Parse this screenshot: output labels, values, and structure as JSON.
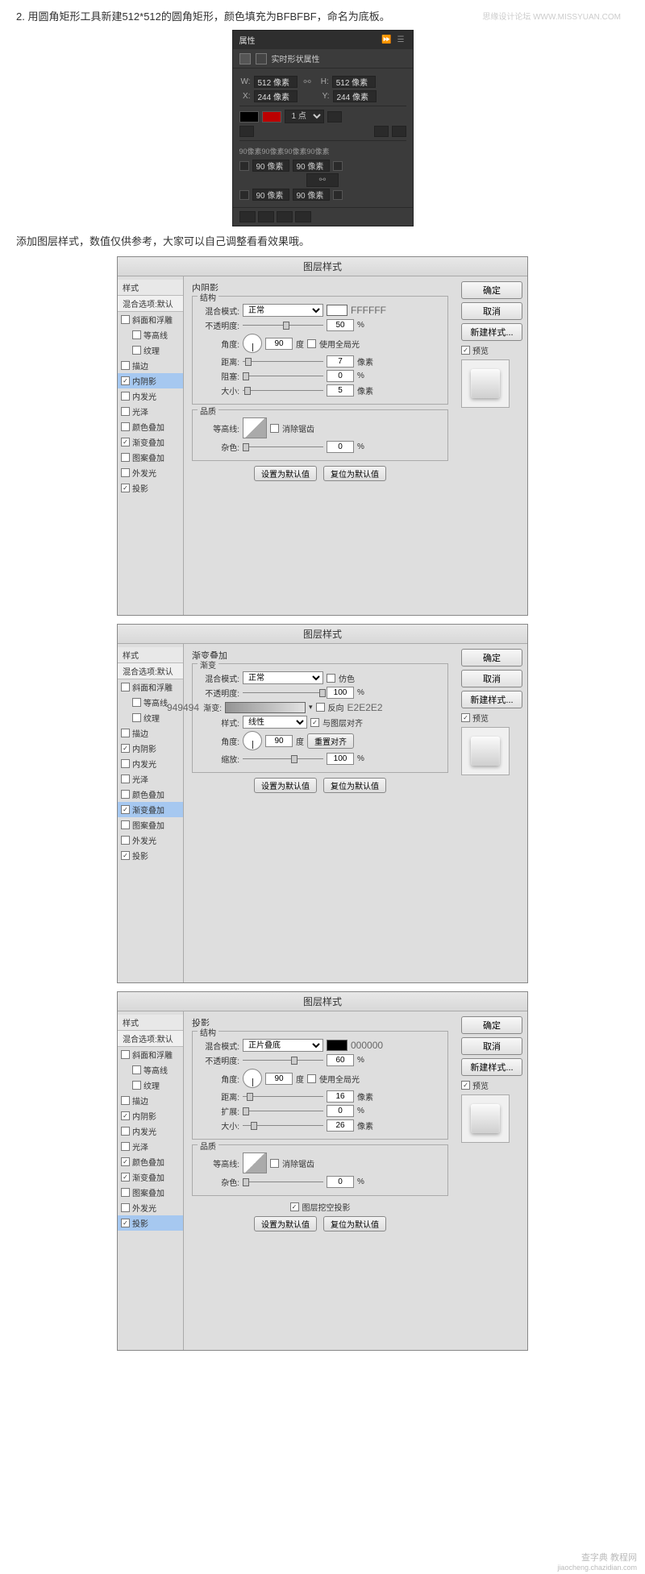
{
  "watermarks": {
    "top": "思缘设计论坛 WWW.MISSYUAN.COM",
    "bottom_l1": "查字典 教程网",
    "bottom_l2": "jiaocheng.chazidian.com"
  },
  "instructions": {
    "step2": "2. 用圆角矩形工具新建512*512的圆角矩形，颜色填充为BFBFBF，命名为底板。",
    "add_style": "添加图层样式，数值仅供参考，大家可以自己调整看看效果哦。"
  },
  "properties": {
    "tab": "属性",
    "title": "实时形状属性",
    "w_lbl": "W:",
    "w_val": "512 像素",
    "h_lbl": "H:",
    "h_val": "512 像素",
    "x_lbl": "X:",
    "x_val": "244 像素",
    "y_lbl": "Y:",
    "y_val": "244 像素",
    "stroke_w": "1 点",
    "corners_hdr": "90像素90像素90像素90像素",
    "c1": "90 像素",
    "c2": "90 像素",
    "c3": "90 像素",
    "c4": "90 像素"
  },
  "style_list": {
    "header": "样式",
    "blend_default": "混合选项:默认",
    "bevel": "斜面和浮雕",
    "contour": "等高线",
    "texture": "纹理",
    "stroke": "描边",
    "inner_shadow": "内阴影",
    "inner_glow": "内发光",
    "satin": "光泽",
    "color_overlay": "颜色叠加",
    "grad_overlay": "渐变叠加",
    "pattern_overlay": "图案叠加",
    "outer_glow": "外发光",
    "drop_shadow": "投影"
  },
  "common": {
    "title": "图层样式",
    "ok": "确定",
    "cancel": "取消",
    "new_style": "新建样式...",
    "preview": "预览",
    "set_default": "设置为默认值",
    "reset_default": "复位为默认值",
    "blend_mode": "混合模式:",
    "opacity": "不透明度:",
    "angle": "角度:",
    "degree": "度",
    "global_light": "使用全局光",
    "distance": "距离:",
    "choke": "阻塞:",
    "spread": "扩展:",
    "size": "大小:",
    "px": "像素",
    "pct": "%",
    "quality": "品质",
    "contour_lbl": "等高线:",
    "antialias": "消除锯齿",
    "noise": "杂色:",
    "structure": "结构"
  },
  "inner_shadow": {
    "section": "内阴影",
    "mode": "正常",
    "color_hex": "FFFFFF",
    "opacity": "50",
    "angle": "90",
    "distance": "7",
    "choke": "0",
    "size": "5",
    "noise": "0"
  },
  "gradient_overlay": {
    "section": "渐变叠加",
    "group": "渐变",
    "mode": "正常",
    "dither": "仿色",
    "opacity": "100",
    "grad_lbl": "渐变:",
    "reverse": "反向",
    "align": "与图层对齐",
    "style_lbl": "样式:",
    "style_val": "线性",
    "angle": "90",
    "reset_align": "重置对齐",
    "scale_lbl": "缩放:",
    "scale": "100",
    "hex_left": "949494",
    "hex_right": "E2E2E2"
  },
  "drop_shadow": {
    "section": "投影",
    "mode": "正片叠底",
    "color_hex": "000000",
    "opacity": "60",
    "angle": "90",
    "distance": "16",
    "spread": "0",
    "size": "26",
    "noise": "0",
    "knockout": "图层挖空投影"
  }
}
